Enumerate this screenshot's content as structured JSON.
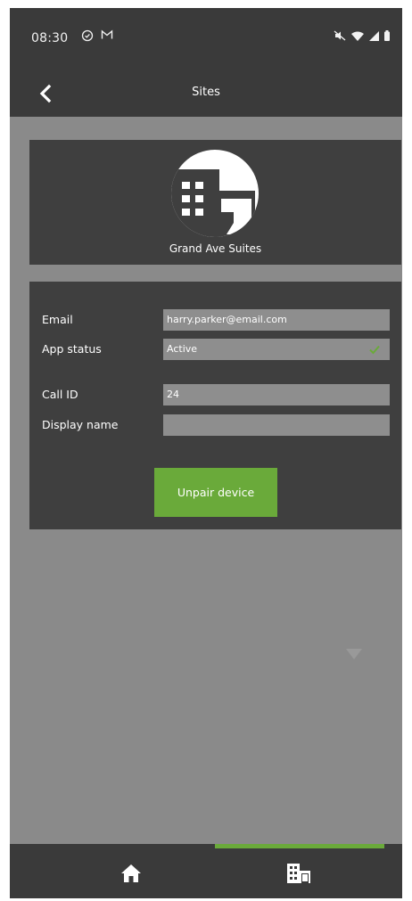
{
  "status_bar": {
    "time": "08:30",
    "left_icons": [
      "alarm-check-icon",
      "gmail-icon"
    ],
    "right_icons": [
      "mute-icon",
      "wifi-icon",
      "signal-icon",
      "battery-icon"
    ]
  },
  "app_bar": {
    "title": "Sites",
    "back_icon": "chevron-left-icon"
  },
  "site": {
    "name": "Grand Ave Suites",
    "avatar_icon": "building-icon"
  },
  "fields": {
    "email": {
      "label": "Email",
      "value": "harry.parker@email.com"
    },
    "app_status": {
      "label": "App status",
      "value": "Active"
    },
    "call_id": {
      "label": "Call ID",
      "value": "24"
    },
    "display_name": {
      "label": "Display name",
      "value": ""
    }
  },
  "actions": {
    "unpair_label": "Unpair device"
  },
  "bottom_nav": {
    "items": [
      {
        "icon": "home-icon",
        "active": false
      },
      {
        "icon": "building-icon",
        "active": true
      }
    ]
  },
  "colors": {
    "bar": "#3a3a3a",
    "card": "#3f3f3f",
    "background": "#8a8a8a",
    "accent": "#6aaa3a"
  }
}
